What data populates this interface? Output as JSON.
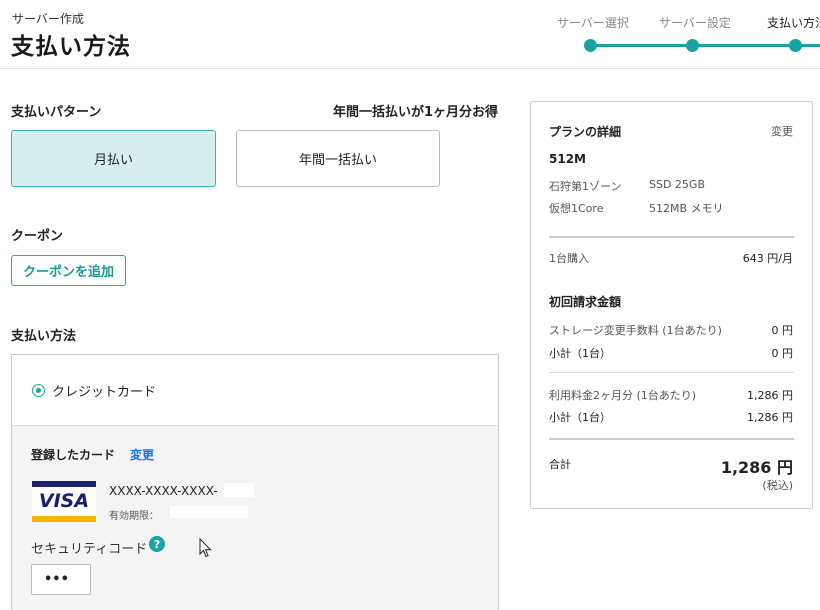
{
  "header": {
    "breadcrumb": "サーバー作成",
    "title": "支払い方法",
    "steps": [
      "サーバー選択",
      "サーバー設定",
      "支払い方法"
    ]
  },
  "payment_pattern": {
    "title": "支払いパターン",
    "promo": "年間一括払いが1ヶ月分お得",
    "options": [
      "月払い",
      "年間一括払い"
    ],
    "selected": "月払い"
  },
  "coupon": {
    "title": "クーポン",
    "button_label": "クーポンを追加"
  },
  "payment_method": {
    "title": "支払い方法",
    "option_label": "クレジットカード",
    "registered_card_label": "登録したカード",
    "change_label": "変更",
    "card_brand": "VISA",
    "card_number": "XXXX-XXXX-XXXX-",
    "expiry_label": "有効期限：",
    "security_code_label": "セキュリティコード",
    "help_icon": "?",
    "security_code_value": "•••"
  },
  "plan": {
    "title": "プランの詳細",
    "change_label": "変更",
    "name": "512M",
    "specs": [
      [
        "石狩第1ゾーン",
        "SSD 25GB"
      ],
      [
        "仮想1Core",
        "512MB メモリ"
      ]
    ],
    "purchase_label": "1台購入",
    "purchase_price": "643 円/月",
    "initial_title": "初回請求金額",
    "storage_fee_label": "ストレージ変更手数料 (1台あたり)",
    "storage_fee_value": "0 円",
    "subtotal1_label": "小計（1台）",
    "subtotal1_value": "0 円",
    "usage_fee_label": "利用料金2ヶ月分 (1台あたり)",
    "usage_fee_value": "1,286 円",
    "subtotal2_label": "小計（1台）",
    "subtotal2_value": "1,286 円",
    "total_label": "合計",
    "total_value": "1,286 円",
    "tax_note": "(税込)"
  },
  "colors": {
    "accent": "#1aa3a0",
    "selected_bg": "#d6f0ef",
    "link": "#1a73e8"
  }
}
